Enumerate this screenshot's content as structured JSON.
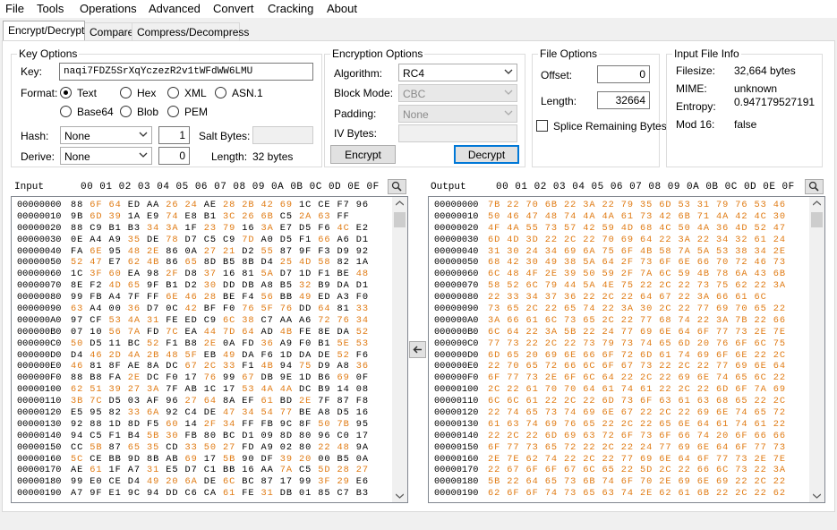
{
  "menu": [
    "File",
    "Tools",
    "Operations",
    "Advanced",
    "Convert",
    "Cracking",
    "About"
  ],
  "tabs": [
    "Encrypt/Decrypt",
    "Compare",
    "Compress/Decompress"
  ],
  "key_options": {
    "title": "Key Options",
    "key_label": "Key:",
    "key_value": "naqi7FDZ5SrXqYczezR2v1tWFdWW6LMU",
    "format_label": "Format:",
    "formats": [
      "Text",
      "Hex",
      "XML",
      "ASN.1",
      "Base64",
      "Blob",
      "PEM"
    ],
    "format_selected": "Text",
    "hash_label": "Hash:",
    "hash_value": "None",
    "hash_iterations": "1",
    "salt_label": "Salt Bytes:",
    "salt_value": "",
    "derive_label": "Derive:",
    "derive_value": "None",
    "derive_num": "0",
    "length_label": "Length:",
    "length_value": "32 bytes"
  },
  "encryption_options": {
    "title": "Encryption Options",
    "algorithm_label": "Algorithm:",
    "algorithm_value": "RC4",
    "block_mode_label": "Block Mode:",
    "block_mode_value": "CBC",
    "padding_label": "Padding:",
    "padding_value": "None",
    "iv_label": "IV Bytes:",
    "iv_value": "",
    "encrypt_label": "Encrypt",
    "decrypt_label": "Decrypt"
  },
  "file_options": {
    "title": "File Options",
    "offset_label": "Offset:",
    "offset_value": "0",
    "length_label": "Length:",
    "length_value": "32664",
    "splice_label": "Splice Remaining Bytes",
    "splice_checked": false
  },
  "input_file_info": {
    "title": "Input File Info",
    "filesize_label": "Filesize:",
    "filesize_value": "32,664 bytes",
    "mime_label": "MIME:",
    "mime_value": "unknown",
    "entropy_label": "Entropy:",
    "entropy_value": "0.947179527191",
    "mod16_label": "Mod 16:",
    "mod16_value": "false"
  },
  "hex_columns": "00 01 02 03 04 05 06 07 08 09 0A 0B 0C 0D 0E 0F",
  "input_label": "Input",
  "output_label": "Output",
  "input_rows": [
    [
      "00000000",
      "88 6F 64 ED AA 26 24 AE 28 2B 42 69 1C CE F7 96"
    ],
    [
      "00000010",
      "9B 6D 39 1A E9 74 E8 B1 3C 26 6B C5 2A 63 FF"
    ],
    [
      "00000020",
      "88 C9 B1 B3 34 3A 1F 23 79 16 3A E7 D5 F6 4C E2"
    ],
    [
      "00000030",
      "0E A4 A9 35 DE 78 D7 C5 C9 7D A0 D5 F1 66 A6 D1"
    ],
    [
      "00000040",
      "FA 6E 95 48 2E 86 0A 27 21 D2 55 87 9F F3 D9 92"
    ],
    [
      "00000050",
      "52 47 E7 62 4B 86 65 8D B5 8B D4 25 4D 58 82 1A"
    ],
    [
      "00000060",
      "1C 3F 60 EA 98 2F D8 37 16 81 5A D7 1D F1 BE 48"
    ],
    [
      "00000070",
      "8E F2 4D 65 9F B1 D2 30 DD DB A8 B5 32 B9 DA D1"
    ],
    [
      "00000080",
      "99 FB A4 7F FF 6E 46 28 BE F4 56 BB 49 ED A3 F0"
    ],
    [
      "00000090",
      "63 A4 00 36 D7 0C 42 BF F0 76 5F 76 DD 64 81 33"
    ],
    [
      "000000A0",
      "97 CF 53 4A 31 FE ED C9 6C 38 C7 AA A6 72 76 34"
    ],
    [
      "000000B0",
      "07 10 56 7A FD 7C EA 44 7D 64 AD 4B FE 8E DA 52"
    ],
    [
      "000000C0",
      "50 D5 11 BC 52 F1 B8 2E 0A FD 36 A9 F0 B1 5E 53"
    ],
    [
      "000000D0",
      "D4 46 2D 4A 2B 48 5F EB 49 DA F6 1D DA DE 52 F6"
    ],
    [
      "000000E0",
      "46 81 8F AE 8A DC 67 2C 33 F1 4B 94 75 D9 A8 36"
    ],
    [
      "000000F0",
      "88 B8 FA 2E DC F0 17 76 99 67 DB 9E 1D B6 69 0F"
    ],
    [
      "00000100",
      "62 51 39 27 3A 7F AB 1C 17 53 4A 4A DC B9 14 08"
    ],
    [
      "00000110",
      "3B 7C D5 03 AF 96 27 64 8A EF 61 BD 2E 7F 87 F8"
    ],
    [
      "00000120",
      "E5 95 82 33 6A 92 C4 DE 47 34 54 77 BE A8 D5 16"
    ],
    [
      "00000130",
      "92 88 1D 8D F5 60 14 2F 34 FF FB 9C 8F 50 7B 95"
    ],
    [
      "00000140",
      "94 C5 F1 B4 5B 30 FB 80 BC D1 09 8D 80 96 C0 17"
    ],
    [
      "00000150",
      "CC 5B 87 65 35 CD 33 50 27 FD A9 02 80 22 48 9A"
    ],
    [
      "00000160",
      "5C CE BB 9D 8B AB 69 17 5B 90 DF 39 20 00 B5 0A"
    ],
    [
      "00000170",
      "AE 61 1F A7 31 E5 D7 C1 BB 16 AA 7A C5 5D 28 27"
    ],
    [
      "00000180",
      "99 E0 CE D4 49 20 6A DE 6C BC 87 17 99 3F 29 E6"
    ],
    [
      "00000190",
      "A7 9F E1 9C 94 DD C6 CA 61 FE 31 DB 01 85 C7 B3"
    ]
  ],
  "output_rows": [
    [
      "00000000",
      "7B 22 70 6B 22 3A 22 79 35 6D 53 31 79 76 53 46"
    ],
    [
      "00000010",
      "50 46 47 48 74 4A 4A 61 73 42 6B 71 4A 42 4C 30"
    ],
    [
      "00000020",
      "4F 4A 55 73 57 42 59 4D 68 4C 50 4A 36 4D 52 47"
    ],
    [
      "00000030",
      "6D 4D 3D 22 2C 22 70 69 64 22 3A 22 34 32 61 24"
    ],
    [
      "00000040",
      "31 30 24 34 69 6A 75 6F 4B 58 7A 5A 53 38 34 2E"
    ],
    [
      "00000050",
      "68 42 30 49 38 5A 64 2F 73 6F 6E 66 70 72 46 73"
    ],
    [
      "00000060",
      "6C 48 4F 2E 39 50 59 2F 7A 6C 59 4B 78 6A 43 6B"
    ],
    [
      "00000070",
      "58 52 6C 79 44 5A 4E 75 22 2C 22 73 75 62 22 3A"
    ],
    [
      "00000080",
      "22 33 34 37 36 22 2C 22 64 67 22 3A 66 61 6C"
    ],
    [
      "00000090",
      "73 65 2C 22 65 74 22 3A 30 2C 22 77 69 70 65 22"
    ],
    [
      "000000A0",
      "3A 66 61 6C 73 65 2C 22 77 68 74 22 3A 7B 22 66"
    ],
    [
      "000000B0",
      "6C 64 22 3A 5B 22 24 77 69 6E 64 6F 77 73 2E 7E"
    ],
    [
      "000000C0",
      "77 73 22 2C 22 73 79 73 74 65 6D 20 76 6F 6C 75"
    ],
    [
      "000000D0",
      "6D 65 20 69 6E 66 6F 72 6D 61 74 69 6F 6E 22 2C"
    ],
    [
      "000000E0",
      "22 70 65 72 66 6C 6F 67 73 22 2C 22 77 69 6E 64"
    ],
    [
      "000000F0",
      "6F 77 73 2E 6F 6C 64 22 2C 22 69 6E 74 65 6C 22"
    ],
    [
      "00000100",
      "2C 22 61 70 70 64 61 74 61 22 2C 22 6D 6F 7A 69"
    ],
    [
      "00000110",
      "6C 6C 61 22 2C 22 6D 73 6F 63 61 63 68 65 22 2C"
    ],
    [
      "00000120",
      "22 74 65 73 74 69 6E 67 22 2C 22 69 6E 74 65 72"
    ],
    [
      "00000130",
      "61 63 74 69 76 65 22 2C 22 65 6E 64 61 74 61 22"
    ],
    [
      "00000140",
      "22 2C 22 6D 69 63 72 6F 73 6F 66 74 20 6F 66 66"
    ],
    [
      "00000150",
      "6F 77 73 65 72 22 2C 22 24 77 69 6E 64 6F 77 73"
    ],
    [
      "00000160",
      "2E 7E 62 74 22 2C 22 77 69 6E 64 6F 77 73 2E 7E"
    ],
    [
      "00000170",
      "22 67 6F 6F 67 6C 65 22 5D 2C 22 66 6C 73 22 3A"
    ],
    [
      "00000180",
      "5B 22 64 65 73 6B 74 6F 70 2E 69 6E 69 22 2C 22"
    ],
    [
      "00000190",
      "62 6F 6F 74 73 65 63 74 2E 62 61 6B 22 2C 22 62"
    ]
  ],
  "accent_color": "#e07b14",
  "default_button_color": "#0078d7"
}
